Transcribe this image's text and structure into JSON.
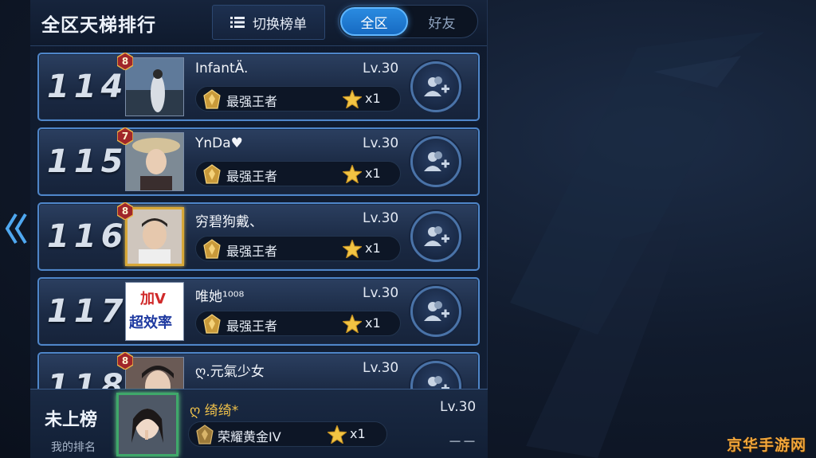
{
  "header": {
    "title": "全区天梯排行",
    "switch_label": "切换榜单",
    "tabs": [
      {
        "label": "全区",
        "active": true
      },
      {
        "label": "好友",
        "active": false
      }
    ]
  },
  "rows": [
    {
      "rank": "114",
      "badge": "8",
      "name": "InfantÄ.",
      "level": "Lv.30",
      "tier": "最强王者",
      "stars": "x1",
      "avatar_frame": "plain"
    },
    {
      "rank": "115",
      "badge": "7",
      "name": "YnDa♥",
      "level": "Lv.30",
      "tier": "最强王者",
      "stars": "x1",
      "avatar_frame": "plain"
    },
    {
      "rank": "116",
      "badge": "8",
      "name": "穷碧狗戴、",
      "level": "Lv.30",
      "tier": "最强王者",
      "stars": "x1",
      "avatar_frame": "gold"
    },
    {
      "rank": "117",
      "badge": "",
      "name": "唯她¹⁰⁰⁸",
      "level": "Lv.30",
      "tier": "最强王者",
      "stars": "x1",
      "avatar_frame": "plain",
      "avatar_text_top": "加V",
      "avatar_text_bottom": "超效率"
    },
    {
      "rank": "118",
      "badge": "8",
      "name": "ღ.元氣少女",
      "level": "Lv.30",
      "tier": "",
      "stars": "",
      "avatar_frame": "plain"
    }
  ],
  "my_rank": {
    "status": "未上榜",
    "label": "我的排名",
    "name": "ღ 绮绮*",
    "level": "Lv.30",
    "tier": "荣耀黄金IV",
    "stars": "x1",
    "rank_value": "－－"
  },
  "watermark": "京华手游网",
  "icons": {
    "back": "chevron-left-double-icon",
    "list": "list-icon",
    "add_friend": "add-friend-icon",
    "tier": "king-tier-icon",
    "star": "star-icon"
  },
  "colors": {
    "accent_blue": "#2a8be0",
    "row_border": "#4f86c9",
    "gold": "#f0c24a",
    "watermark": "#f2a63a"
  }
}
